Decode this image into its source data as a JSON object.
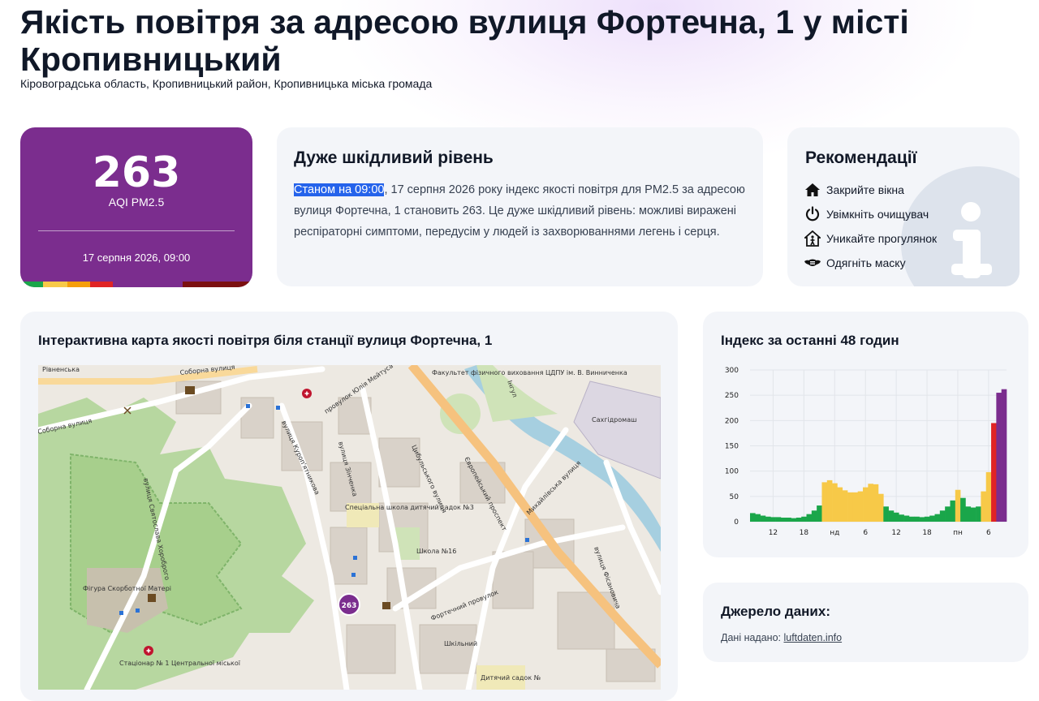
{
  "page": {
    "title": "Якість повітря за адресою вулиця Фортечна, 1 у місті Кропивницький",
    "subtitle": "Кіровоградська область, Кропивницький район, Кропивницька міська громада"
  },
  "aqi": {
    "value": "263",
    "unit": "AQI PM2.5",
    "date": "17 серпня 2026, 09:00",
    "color": "#7b2d8e",
    "scale_colors": [
      "#1aa64a",
      "#f7c948",
      "#f59e0b",
      "#e02424",
      "#7b2d8e",
      "#7b1010"
    ]
  },
  "description": {
    "title": "Дуже шкідливий рівень",
    "highlight": "Станом на 09:00",
    "text": ", 17 серпня 2026 року індекс якості повітря для PM2.5 за адресою вулиця Фортечна, 1 становить 263. Це дуже шкідливий рівень: можливі виражені респіраторні симптоми, передусім у людей із захворюваннями легень і серця."
  },
  "recommendations": {
    "title": "Рекомендації",
    "items": [
      {
        "label": "Закрийте вікна",
        "icon": "house-icon"
      },
      {
        "label": "Увімкніть очищувач",
        "icon": "power-icon"
      },
      {
        "label": "Уникайте прогулянок",
        "icon": "home-walk-icon"
      },
      {
        "label": "Одягніть маску",
        "icon": "mask-icon"
      }
    ]
  },
  "map": {
    "title": "Інтерактивна карта якості повітря біля станції вулиця Фортечна, 1",
    "marker_value": "263",
    "labels": {
      "sobornaya": "Соборна вулиця",
      "sobornaya2": "Соборна вулиця",
      "rivnenska": "Рівненська",
      "kurganyatnikova": "вулиця Куроп'ятникова",
      "meytusa": "провулок Юлія Мейтуса",
      "zinchenka": "вулиця Зінченка",
      "tsybulskoho": "Цибульського вулиця",
      "yevropeyskyi": "Європейський проспект",
      "mykhailivska": "Михайлівська вулиця",
      "svyatoslava": "вулиця Святослава Хороброго",
      "fortechnyi": "Фортечний провулок",
      "fisanovycha": "вулиця Фісановича",
      "shkilnyi": "Шкільний",
      "inhul": "Інгул",
      "sakhidormash": "Сахгідромаш",
      "school": "Спеціальна школа дитячий садок №3",
      "school16": "Школа №16",
      "statue": "Фігура Скорботної Матері",
      "hospital": "Стаціонар № 1 Центральної міської",
      "faculty": "Факультет фізичного виховання ЦДПУ ім. В. Винниченка",
      "kindergarten": "Дитячий садок №"
    }
  },
  "chart": {
    "title": "Індекс за останні 48 годин"
  },
  "chart_data": {
    "type": "bar",
    "title": "Індекс за останні 48 годин",
    "xlabel": "",
    "ylabel": "",
    "ylim": [
      0,
      300
    ],
    "yticks": [
      0,
      50,
      100,
      150,
      200,
      250,
      300
    ],
    "xticks": [
      {
        "index": 4,
        "label": "12"
      },
      {
        "index": 10,
        "label": "18"
      },
      {
        "index": 16,
        "label": "нд"
      },
      {
        "index": 22,
        "label": "6"
      },
      {
        "index": 28,
        "label": "12"
      },
      {
        "index": 34,
        "label": "18"
      },
      {
        "index": 40,
        "label": "пн"
      },
      {
        "index": 46,
        "label": "6"
      }
    ],
    "grid": true,
    "values": [
      17,
      15,
      12,
      10,
      9,
      9,
      8,
      8,
      7,
      8,
      10,
      15,
      22,
      32,
      78,
      82,
      76,
      68,
      62,
      58,
      58,
      60,
      68,
      75,
      74,
      55,
      30,
      22,
      18,
      14,
      12,
      10,
      10,
      9,
      10,
      12,
      15,
      22,
      30,
      42,
      63,
      47,
      30,
      28,
      30,
      60,
      98,
      195,
      255,
      262
    ],
    "colors": {
      "good": "#1aa64a",
      "moderate": "#f7c948",
      "usg": "#f59e0b",
      "unhealthy": "#e02424",
      "very_unhealthy": "#7b2d8e"
    }
  },
  "source": {
    "title": "Джерело даних:",
    "prefix": "Дані надано:",
    "link": "luftdaten.info"
  }
}
